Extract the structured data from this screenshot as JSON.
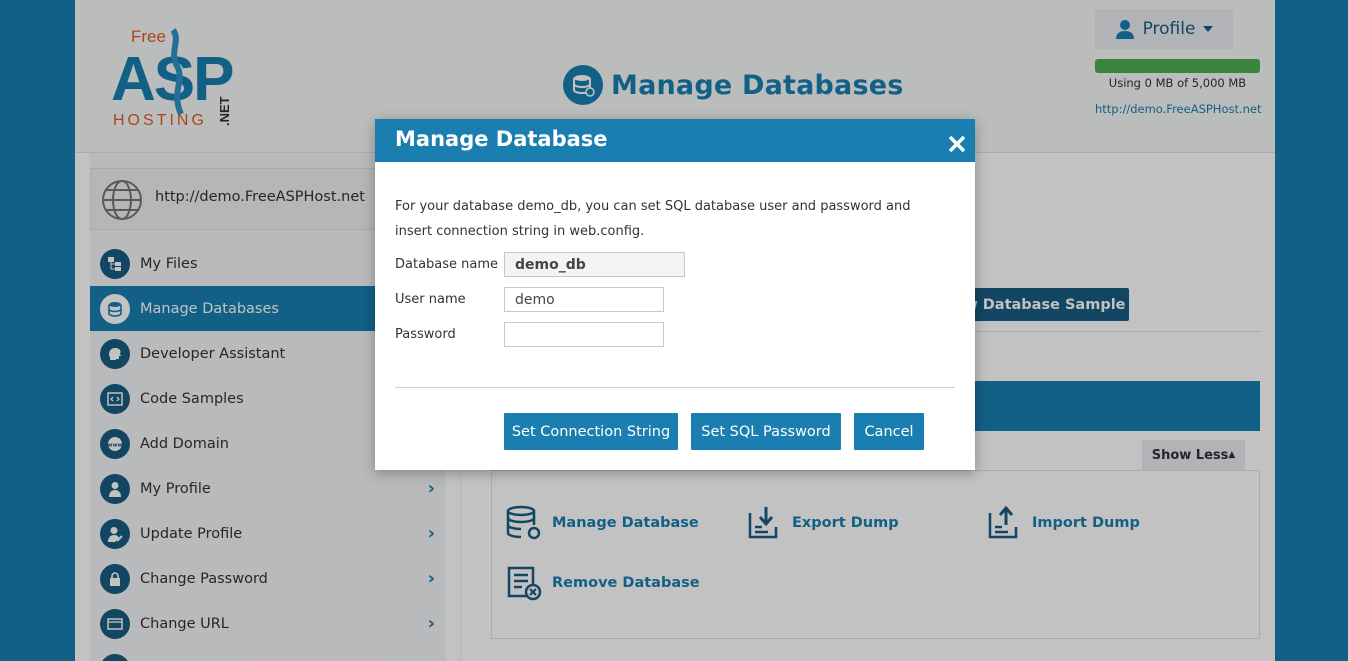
{
  "header": {
    "logo": {
      "top": "Free",
      "big": "ASP",
      "bottom": "HOSTING",
      "net": ".NET"
    },
    "title": "Manage Databases",
    "profile_label": "Profile",
    "usage_text": "Using 0 MB of 5,000 MB",
    "usage_fraction": 1.0,
    "site_link": "http://demo.FreeASPHost.net"
  },
  "sidebar": {
    "url": "http://demo.FreeASPHost.net",
    "items": [
      {
        "label": "My Files",
        "icon": "files-icon"
      },
      {
        "label": "Manage Databases",
        "icon": "database-icon",
        "active": true
      },
      {
        "label": "Developer Assistant",
        "icon": "head-icon"
      },
      {
        "label": "Code Samples",
        "icon": "code-icon"
      },
      {
        "label": "Add Domain",
        "icon": "www-icon"
      },
      {
        "label": "My Profile",
        "icon": "user-icon",
        "chevron": true
      },
      {
        "label": "Update Profile",
        "icon": "user-edit-icon",
        "chevron": true
      },
      {
        "label": "Change Password",
        "icon": "lock-icon",
        "chevron": true
      },
      {
        "label": "Change URL",
        "icon": "url-icon",
        "chevron": true
      }
    ]
  },
  "content": {
    "new_db_button": "ew Database Sample",
    "show_less": "Show Less",
    "actions": {
      "manage": "Manage Database",
      "export": "Export Dump",
      "import": "Import Dump",
      "remove": "Remove Database"
    }
  },
  "modal": {
    "title": "Manage Database",
    "description": "For your database demo_db, you can set SQL database user and password and insert connection string in web.config.",
    "db_name_label": "Database name",
    "db_name_value": "demo_db",
    "user_label": "User name",
    "user_value": "demo",
    "password_label": "Password",
    "password_value": "",
    "buttons": {
      "set_conn": "Set Connection String",
      "set_sql": "Set SQL Password",
      "cancel": "Cancel"
    }
  },
  "colors": {
    "brand": "#1a7fb0",
    "dark": "#1a5c82",
    "usage": "#4caf50"
  }
}
